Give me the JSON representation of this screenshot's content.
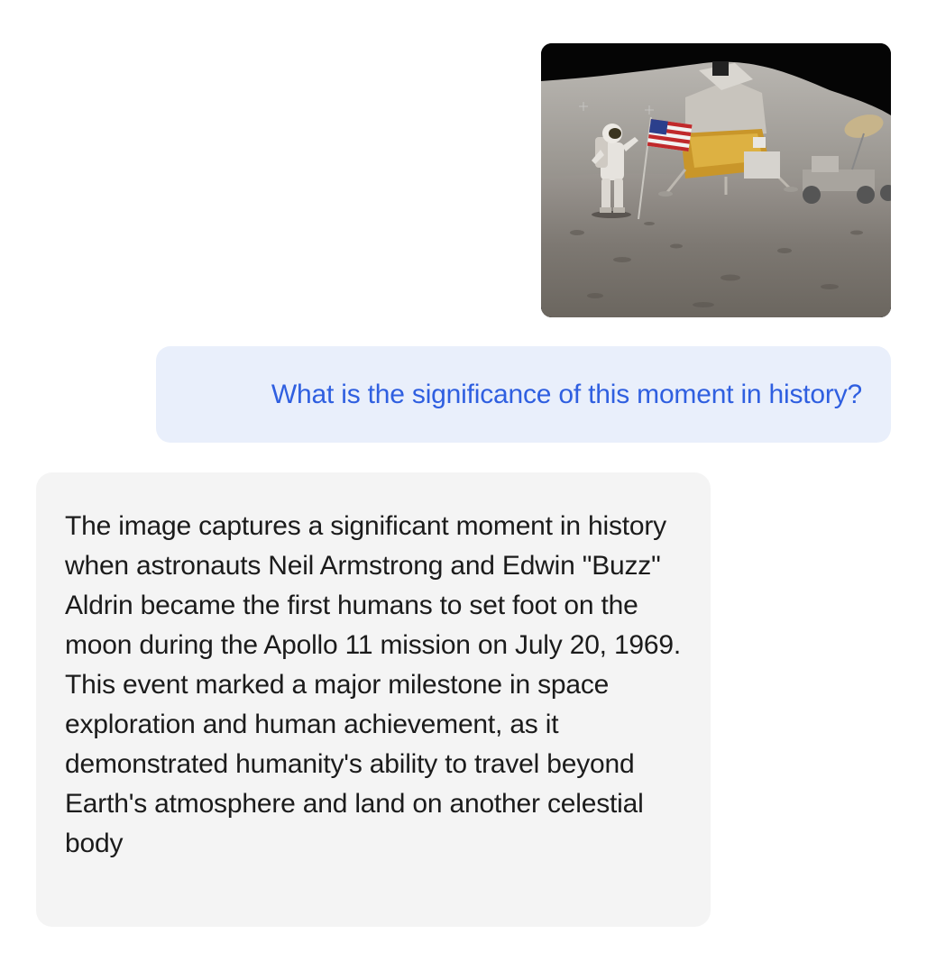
{
  "conversation": {
    "user_image": {
      "alt": "Astronaut saluting beside an American flag on the lunar surface with the lunar module and a lunar rover in the background",
      "icon": "moon-landing-photo"
    },
    "user_message": "What is the significance of this moment in history?",
    "assistant_message": "The image captures a significant moment in history when astronauts Neil Armstrong and Edwin \"Buzz\" Aldrin became the first humans to set foot on the moon during the Apollo 11 mission on July 20, 1969. This event marked a major milestone in space exploration and human achievement, as it demonstrated humanity's ability to travel beyond Earth's atmosphere and land on another celestial body"
  },
  "colors": {
    "user_bubble_bg": "#e9effb",
    "user_text": "#2f5fe0",
    "assistant_bubble_bg": "#f4f4f4",
    "assistant_text": "#1b1b1b"
  }
}
